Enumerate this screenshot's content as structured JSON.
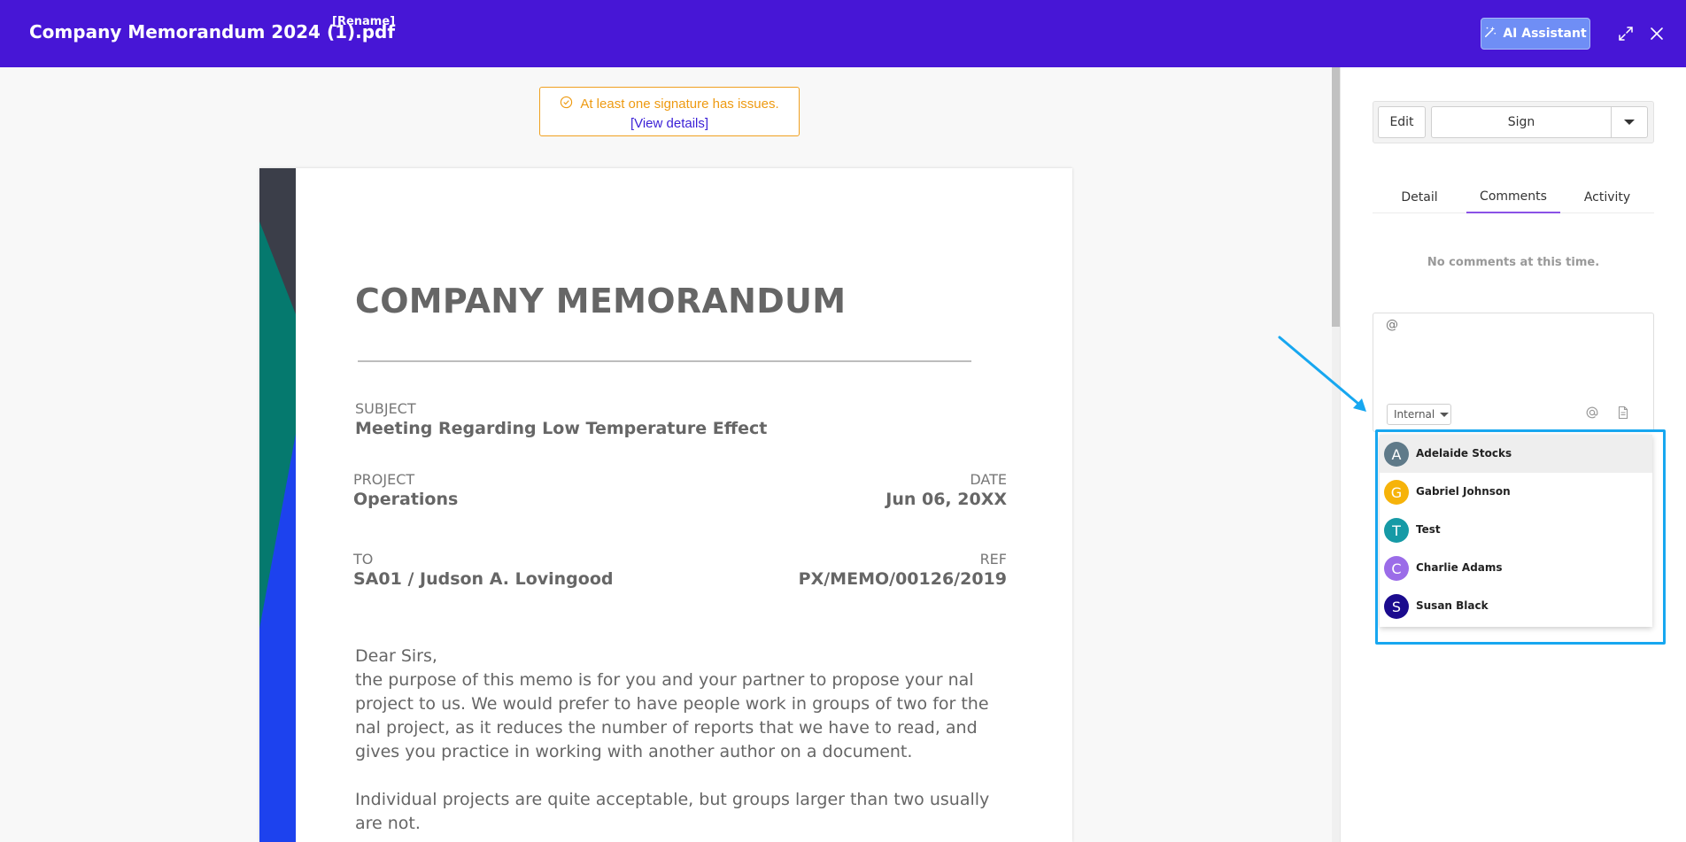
{
  "header": {
    "title": "Company Memorandum 2024 (1).pdf",
    "rename_label": "[Rename]",
    "ai_button_label": "AI Assistant",
    "bg_color": "#4716d6"
  },
  "viewer": {
    "signature_alert": {
      "message": "At least one signature has issues.",
      "link_label": "[View details]"
    },
    "memo": {
      "title": "COMPANY MEMORANDUM",
      "subject_label": "SUBJECT",
      "subject_value": "Meeting Regarding Low Temperature Effect",
      "project_label": "PROJECT",
      "project_value": "Operations",
      "date_label": "DATE",
      "date_value": "Jun 06, 20XX",
      "to_label": "TO",
      "to_value": "SA01 / Judson A. Lovingood",
      "ref_label": "REF",
      "ref_value": "PX/MEMO/00126/2019",
      "paragraph1": "Dear Sirs,\nthe purpose of this memo is for you and your partner to propose your nal project to us. We would prefer to have people work in groups of two for the nal project, as it reduces the number of reports that we have to read, and gives you practice in working with another author on a document.",
      "paragraph2": "Individual projects are quite acceptable, but groups larger than two usually are not."
    }
  },
  "panel": {
    "edit_label": "Edit",
    "sign_label": "Sign",
    "tabs": [
      {
        "label": "Detail",
        "active": false
      },
      {
        "label": "Comments",
        "active": true
      },
      {
        "label": "Activity",
        "active": false
      }
    ],
    "no_comments_text": "No comments at this time.",
    "comment_input_value": "@",
    "visibility_select": "Internal",
    "mention_suggestions": [
      {
        "initial": "A",
        "name": "Adelaide Stocks",
        "color": "#5f7a89",
        "highlighted": true
      },
      {
        "initial": "G",
        "name": "Gabriel Johnson",
        "color": "#f6b30a",
        "highlighted": false
      },
      {
        "initial": "T",
        "name": "Test",
        "color": "#169aa6",
        "highlighted": false
      },
      {
        "initial": "C",
        "name": "Charlie Adams",
        "color": "#9b6ce8",
        "highlighted": false
      },
      {
        "initial": "S",
        "name": "Susan Black",
        "color": "#1b0b8e",
        "highlighted": false
      }
    ]
  },
  "annotation": {
    "color": "#17a7f0"
  }
}
